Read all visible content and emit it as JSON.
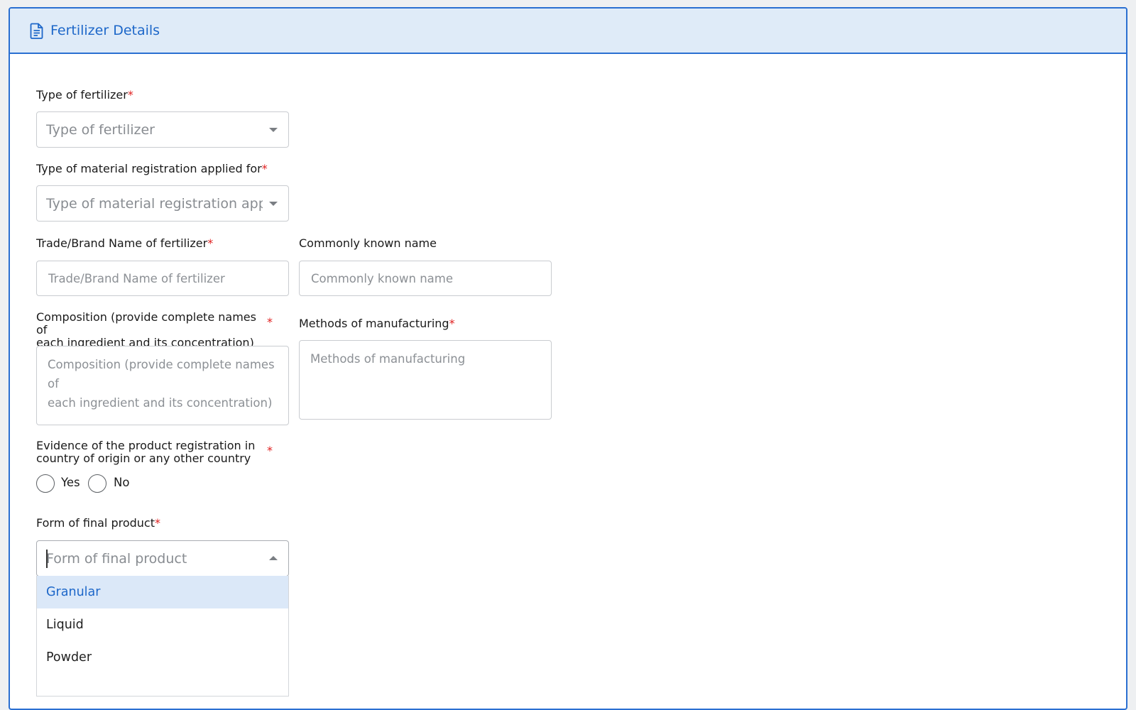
{
  "panel": {
    "title": "Fertilizer Details",
    "icon": "document-icon"
  },
  "fields": {
    "type_of_fertilizer": {
      "label": "Type of fertilizer",
      "required_mark": "*",
      "placeholder": "Type of fertilizer"
    },
    "material_registration": {
      "label": "Type of material registration applied for",
      "required_mark": "*",
      "placeholder": "Type of material registration applie"
    },
    "trade_brand_name": {
      "label": "Trade/Brand Name of fertilizer",
      "required_mark": "*",
      "placeholder": "Trade/Brand Name of fertilizer"
    },
    "commonly_known_name": {
      "label": "Commonly known name",
      "placeholder": "Commonly known name"
    },
    "composition": {
      "label_line1": "Composition (provide complete names of",
      "label_line2": "each ingredient and its concentration)",
      "required_mark": "*",
      "placeholder_line1": "Composition (provide complete names of",
      "placeholder_line2": "each ingredient and its concentration)"
    },
    "methods_of_manufacturing": {
      "label": "Methods of manufacturing",
      "required_mark": "*",
      "placeholder": "Methods of manufacturing"
    },
    "evidence_registration": {
      "label_line1": "Evidence of the product registration in",
      "label_line2": "country of origin or any other country",
      "required_mark": "*",
      "options": [
        "Yes",
        "No"
      ]
    },
    "form_of_final_product": {
      "label": "Form of final product",
      "required_mark": "*",
      "placeholder": "Form of final product",
      "dropdown_open": true,
      "options": [
        "Granular",
        "Liquid",
        "Powder"
      ],
      "highlighted_option": "Granular"
    }
  },
  "colors": {
    "accent": "#1d67c9",
    "header_bg": "#dfebf8",
    "border_accent": "#2a6fd1",
    "required": "#e02020",
    "highlight_bg": "#dbe8f8"
  }
}
